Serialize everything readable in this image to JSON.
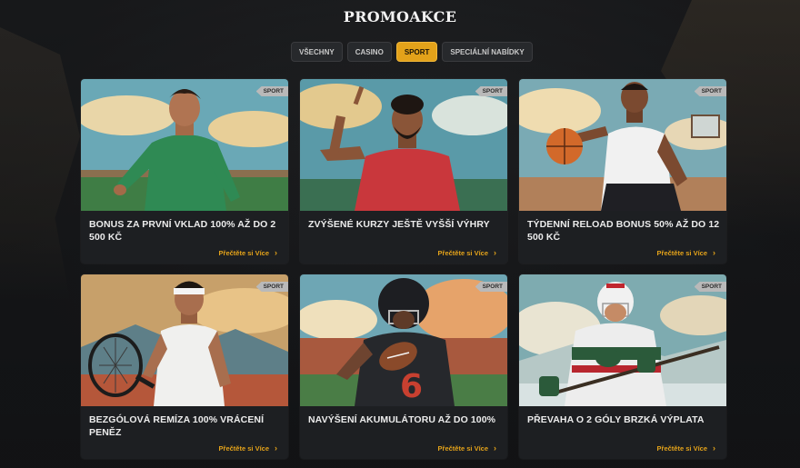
{
  "page": {
    "title": "PROMOAKCE"
  },
  "tabs": [
    {
      "label": "VŠECHNY",
      "active": false
    },
    {
      "label": "CASINO",
      "active": false
    },
    {
      "label": "SPORT",
      "active": true
    },
    {
      "label": "SPECIÁLNÍ NABÍDKY",
      "active": false
    }
  ],
  "promos": [
    {
      "badge": "SPORT",
      "title": "BONUS ZA PRVNÍ VKLAD 100% AŽ DO 2 500 KČ",
      "link": "Přečtěte si Více",
      "image": "soccer-player-illustration"
    },
    {
      "badge": "SPORT",
      "title": "ZVÝŠENÉ KURZY JEŠTĚ VYŠŠÍ VÝHRY",
      "link": "Přečtěte si Více",
      "image": "fan-pointing-illustration"
    },
    {
      "badge": "SPORT",
      "title": "TÝDENNÍ RELOAD BONUS 50% AŽ DO 12 500 KČ",
      "link": "Přečtěte si Více",
      "image": "basketball-player-illustration"
    },
    {
      "badge": "SPORT",
      "title": "BEZGÓLOVÁ REMÍZA 100% VRÁCENÍ PENĚZ",
      "link": "Přečtěte si Více",
      "image": "tennis-player-illustration"
    },
    {
      "badge": "SPORT",
      "title": "NAVÝŠENÍ AKUMULÁTORU AŽ DO 100%",
      "link": "Přečtěte si Více",
      "image": "american-football-player-illustration"
    },
    {
      "badge": "SPORT",
      "title": "PŘEVAHA O 2 GÓLY BRZKÁ VÝPLATA",
      "link": "Přečtěte si Více",
      "image": "hockey-player-illustration"
    }
  ],
  "icons": {
    "read_more": "chevron-right-icon"
  },
  "colors": {
    "accent": "#e3a21a",
    "card": "#1d1f22",
    "background": "#16181b"
  }
}
